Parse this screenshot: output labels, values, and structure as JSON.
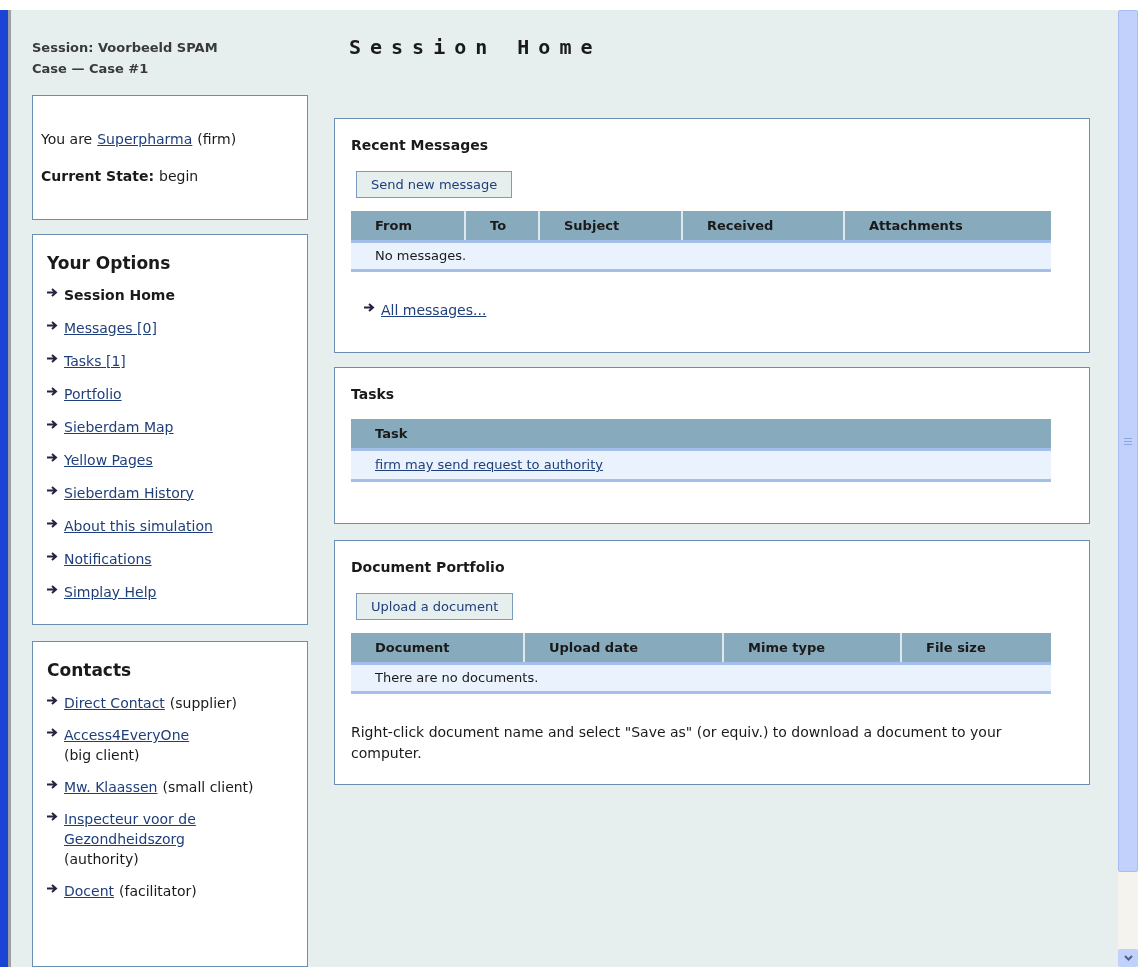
{
  "session_title": "Session: Voorbeeld SPAM Case — Case #1",
  "identity": {
    "prefix": "You are",
    "link": "Superpharma",
    "suffix": "(firm)"
  },
  "current_state": {
    "label": "Current State:",
    "value": "begin"
  },
  "options": {
    "title": "Your Options",
    "items": [
      {
        "label": "Session Home",
        "selected": true
      },
      {
        "label": "Messages [0]",
        "selected": false
      },
      {
        "label": "Tasks [1]",
        "selected": false
      },
      {
        "label": "Portfolio",
        "selected": false
      },
      {
        "label": "Sieberdam Map",
        "selected": false
      },
      {
        "label": "Yellow Pages",
        "selected": false
      },
      {
        "label": "Sieberdam History",
        "selected": false
      },
      {
        "label": "About this simulation",
        "selected": false
      },
      {
        "label": "Notifications",
        "selected": false
      },
      {
        "label": "Simplay Help",
        "selected": false
      }
    ]
  },
  "contacts": {
    "title": "Contacts",
    "items": [
      {
        "name": "Direct Contact",
        "role": "(supplier)"
      },
      {
        "name": "Access4EveryOne",
        "role": "(big client)"
      },
      {
        "name": "Mw. Klaassen",
        "role": "(small client)"
      },
      {
        "name": "Inspecteur voor de Gezondheidszorg",
        "role": "(authority)"
      },
      {
        "name": "Docent",
        "role": "(facilitator)"
      }
    ]
  },
  "page_title": "Session Home",
  "messages": {
    "title": "Recent Messages",
    "button": "Send new message",
    "columns": [
      "From",
      "To",
      "Subject",
      "Received",
      "Attachments"
    ],
    "empty": "No messages.",
    "link": "All messages..."
  },
  "tasks": {
    "title": "Tasks",
    "columns": [
      "Task"
    ],
    "rows": [
      "firm may send request to authority"
    ]
  },
  "portfolio": {
    "title": "Document Portfolio",
    "button": "Upload a document",
    "columns": [
      "Document",
      "Upload date",
      "Mime type",
      "File size"
    ],
    "empty": "There are no documents.",
    "note": "Right-click document name and select \"Save as\" (or equiv.) to download a document to your computer."
  }
}
